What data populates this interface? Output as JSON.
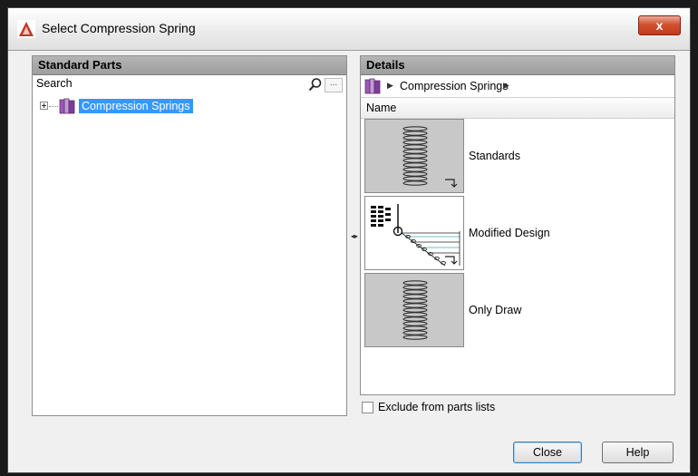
{
  "window": {
    "title": "Select Compression Spring",
    "close_glyph": "x"
  },
  "left_panel": {
    "header": "Standard Parts",
    "search_label": "Search",
    "more_label": "...",
    "tree": [
      {
        "label": "Compression Springs",
        "selected": true
      }
    ]
  },
  "right_panel": {
    "header": "Details",
    "breadcrumb": "Compression Springs",
    "column_header": "Name",
    "items": [
      {
        "label": "Standards",
        "icon": "spring-standard-icon"
      },
      {
        "label": "Modified Design",
        "icon": "spring-design-diagram-icon"
      },
      {
        "label": "Only Draw",
        "icon": "spring-draw-icon"
      }
    ]
  },
  "exclude_checkbox": {
    "label": "Exclude from parts lists",
    "checked": false
  },
  "buttons": {
    "close": "Close",
    "help": "Help"
  },
  "colors": {
    "selection": "#3399ff",
    "panel_header": "#a8a8a8",
    "close_button": "#c9432a"
  }
}
